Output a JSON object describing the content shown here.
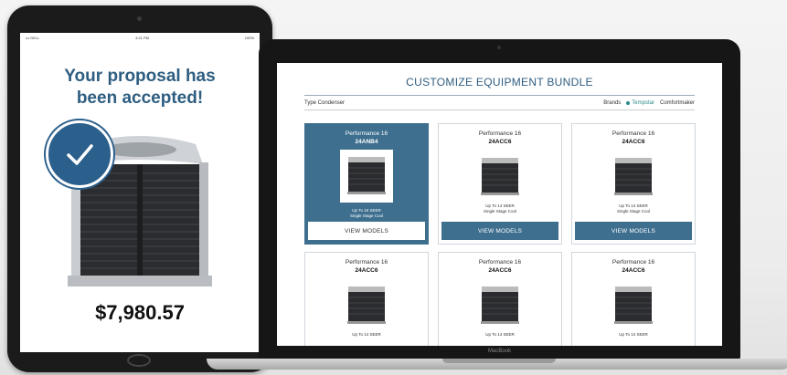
{
  "tablet": {
    "status": {
      "carrier": "••• DELL ",
      "time": "4:21 PM",
      "battery": "100%"
    },
    "proposal_title_line1": "Your proposal has",
    "proposal_title_line2": "been accepted!",
    "price": "$7,980.57",
    "check_icon": "checkmark-icon"
  },
  "laptop": {
    "brand_label": "MacBook",
    "app_title": "CUSTOMIZE EQUIPMENT BUNDLE",
    "filter": {
      "type_label": "Type Condenser",
      "brands_label": "Brands",
      "brand_active": "Tempstar",
      "brand_other": "Comfortmaker"
    },
    "cards": [
      {
        "performance": "Performance 16",
        "model": "24ANB4",
        "seer_line1": "Up To 16 SEER",
        "seer_line2": "Single Stage Cool",
        "button": "VIEW MODELS",
        "selected": true
      },
      {
        "performance": "Performance 16",
        "model": "24ACC6",
        "seer_line1": "Up To 14 SEER",
        "seer_line2": "Single Stage Cool",
        "button": "VIEW MODELS",
        "selected": false
      },
      {
        "performance": "Performance 16",
        "model": "24ACC6",
        "seer_line1": "Up To 14 SEER",
        "seer_line2": "Single Stage Cool",
        "button": "VIEW MODELS",
        "selected": false
      },
      {
        "performance": "Performance 16",
        "model": "24ACC6",
        "seer_line1": "Up To 14 SEER",
        "seer_line2": "",
        "button": "",
        "selected": false
      },
      {
        "performance": "Performance 16",
        "model": "24ACC6",
        "seer_line1": "Up To 14 SEER",
        "seer_line2": "",
        "button": "",
        "selected": false
      },
      {
        "performance": "Performance 16",
        "model": "24ACC6",
        "seer_line1": "Up To 14 SEER",
        "seer_line2": "",
        "button": "",
        "selected": false
      }
    ]
  },
  "colors": {
    "accent": "#2e5d80",
    "card_selected": "#3e6f8f",
    "brand_active": "#2e8a8a"
  }
}
